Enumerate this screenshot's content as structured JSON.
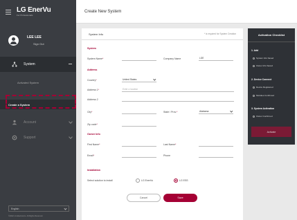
{
  "app": {
    "logo": "LG EnerVu",
    "logo_sub": "For Professionals"
  },
  "user": {
    "name": "LEE LEE",
    "sign_out": "Sign Out"
  },
  "sidebar": {
    "system_label": "System",
    "activated_system": "Activated System",
    "create_system": "Create a System",
    "account_label": "Account",
    "support_label": "Support",
    "language": "English",
    "copyright": "©2022 LG Electronics. All Rights Reserved."
  },
  "header": {
    "title": "Create New System"
  },
  "form": {
    "head_title": "System Info",
    "required_note": "* is required for System Creation",
    "section_system": "System",
    "system_name_label": "System Name",
    "company_name_label": "Company Name",
    "company_name_value": "LGE",
    "section_address": "Address",
    "country_label": "Country",
    "country_value": "United States",
    "address1_label": "Address 1",
    "address1_placeholder": "Enter a location",
    "address2_label": "Address 2",
    "city_label": "City",
    "state_label": "State / Prov.",
    "state_value": "Alabama",
    "zip_label": "Zip code",
    "section_owner": "Owner Info",
    "first_name_label": "First Name",
    "last_name_label": "Last Name",
    "email_label": "Email",
    "phone_label": "Phone",
    "section_installation": "Installation",
    "install_question": "Select solution to install",
    "option_ess": "LG EnerVu",
    "option_ess2": "LG ESS",
    "cancel_label": "Cancel",
    "save_label": "Save"
  },
  "checklist": {
    "title": "Activation Checklist",
    "sec1": "1. Add",
    "sec1_items": [
      "System Info Saved",
      "Owner Info Saved"
    ],
    "sec2": "2. Device Connect",
    "sec2_items": [
      "Device Registered",
      "Modules Confirmed"
    ],
    "sec3": "3. System Activation",
    "sec3_items": [
      "Owner Confirmed"
    ],
    "activate_label": "Activate"
  },
  "colors": {
    "accent": "#a50034",
    "sidebar": "#3a3d42",
    "checklist": "#2e3136"
  }
}
